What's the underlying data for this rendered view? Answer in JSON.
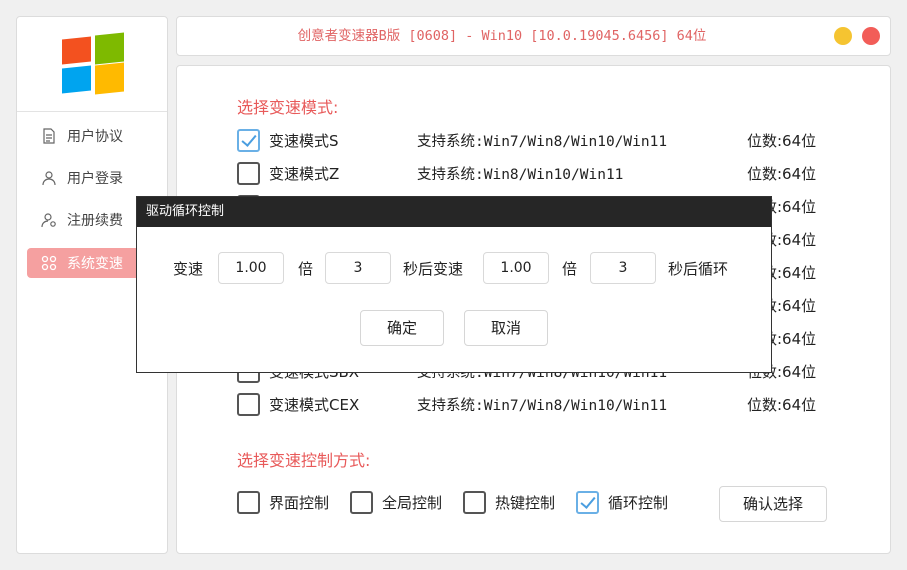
{
  "window": {
    "title": "创意者变速器B版 [0608]  - Win10 [10.0.19045.6456] 64位",
    "minimize_color": "#f5c431",
    "close_color": "#f25d58"
  },
  "logo": {
    "icon": "windows-logo-icon",
    "colors": [
      "#f3511f",
      "#7eba00",
      "#00a4ef",
      "#ffba00"
    ]
  },
  "sidebar": {
    "items": [
      {
        "label": "用户协议",
        "icon": "document-icon",
        "active": false
      },
      {
        "label": "用户登录",
        "icon": "user-icon",
        "active": false
      },
      {
        "label": "注册续费",
        "icon": "user-gear-icon",
        "active": false
      },
      {
        "label": "系统变速",
        "icon": "grid-icon",
        "active": true
      }
    ]
  },
  "modes": {
    "section_title": "选择变速模式:",
    "items": [
      {
        "name": "变速模式S",
        "support": "支持系统:Win7/Win8/Win10/Win11",
        "bits": "位数:64位",
        "checked": true
      },
      {
        "name": "变速模式Z",
        "support": "支持系统:Win8/Win10/Win11",
        "bits": "位数:64位",
        "checked": false
      },
      {
        "name": "",
        "support": "",
        "bits": "位数:64位",
        "checked": false
      },
      {
        "name": "",
        "support": "",
        "bits": "位数:64位",
        "checked": false
      },
      {
        "name": "",
        "support": "",
        "bits": "位数:64位",
        "checked": false
      },
      {
        "name": "",
        "support": "",
        "bits": "位数:64位",
        "checked": false
      },
      {
        "name": "",
        "support": "",
        "bits": "位数:64位",
        "checked": false
      },
      {
        "name": "变速模式SBX",
        "support": "支持系统:Win7/Win8/Win10/Win11",
        "bits": "位数:64位",
        "checked": false
      },
      {
        "name": "变速模式CEX",
        "support": "支持系统:Win7/Win8/Win10/Win11",
        "bits": "位数:64位",
        "checked": false
      }
    ]
  },
  "control": {
    "section_title": "选择变速控制方式:",
    "options": [
      {
        "label": "界面控制",
        "checked": false
      },
      {
        "label": "全局控制",
        "checked": false
      },
      {
        "label": "热键控制",
        "checked": false
      },
      {
        "label": "循环控制",
        "checked": true
      }
    ],
    "confirm_label": "确认选择"
  },
  "dialog": {
    "title": "驱动循环控制",
    "label_speed": "变速",
    "speed1": "1.00",
    "label_times1": "倍",
    "seconds1": "3",
    "label_after_speed": "秒后变速",
    "speed2": "1.00",
    "label_times2": "倍",
    "seconds2": "3",
    "label_after_loop": "秒后循环",
    "ok_label": "确定",
    "cancel_label": "取消"
  }
}
